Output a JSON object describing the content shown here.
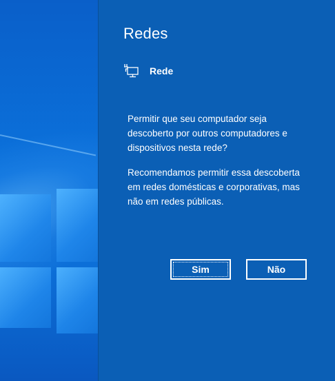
{
  "flyout": {
    "title": "Redes",
    "network_name": "Rede",
    "icon": "network-computer-icon",
    "question": "Permitir que seu computador seja descoberto por outros computadores e dispositivos nesta rede?",
    "recommendation": "Recomendamos permitir essa descoberta em redes domésticas e corporativas, mas não em redes públicas.",
    "buttons": {
      "yes_label": "Sim",
      "no_label": "Não"
    }
  },
  "colors": {
    "panel": "#0b5fb5",
    "text": "#ffffff"
  }
}
